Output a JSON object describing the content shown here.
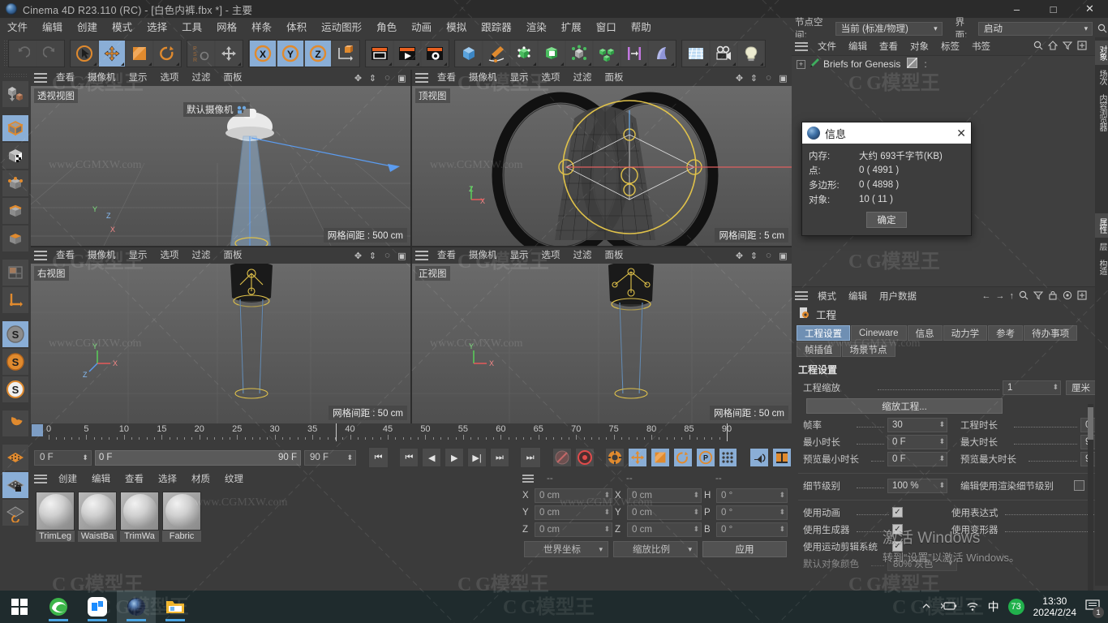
{
  "titlebar": {
    "title": "Cinema 4D R23.110 (RC) - [白色内裤.fbx *] - 主要",
    "minimize": "–",
    "maximize": "□",
    "close": "✕"
  },
  "menubar": {
    "items": [
      "文件",
      "编辑",
      "创建",
      "模式",
      "选择",
      "工具",
      "网格",
      "样条",
      "体积",
      "运动图形",
      "角色",
      "动画",
      "模拟",
      "跟踪器",
      "渲染",
      "扩展",
      "窗口",
      "帮助"
    ]
  },
  "topright": {
    "node_space_label": "节点空间:",
    "node_space_value": "当前 (标准/物理)",
    "layout_label": "界面:",
    "layout_value": "启动",
    "search_icon": "search-icon"
  },
  "object_manager": {
    "menu": [
      "文件",
      "编辑",
      "查看",
      "对象",
      "标签",
      "书签"
    ],
    "icons": [
      "search-icon",
      "home-icon",
      "filter-icon",
      "plus-icon"
    ],
    "tree": [
      {
        "expand": "+",
        "name": "Briefs for Genesis",
        "tag": "tag-icon",
        "dots": ":"
      }
    ]
  },
  "attribute_manager": {
    "menu": [
      "模式",
      "编辑",
      "用户数据"
    ],
    "icons": [
      "back-arrow-icon",
      "forward-arrow-icon",
      "up-arrow-icon",
      "search-icon",
      "filter-icon",
      "lock-icon",
      "record-icon",
      "plus-icon"
    ],
    "object_title": "工程",
    "tabs": [
      {
        "label": "工程设置",
        "active": true
      },
      {
        "label": "Cineware",
        "active": false
      },
      {
        "label": "信息",
        "active": false
      },
      {
        "label": "动力学",
        "active": false
      },
      {
        "label": "参考",
        "active": false
      },
      {
        "label": "待办事项",
        "active": false
      },
      {
        "label": "帧插值",
        "active": false
      },
      {
        "label": "场景节点",
        "active": false
      }
    ],
    "section_title": "工程设置",
    "rows_left": [
      {
        "name": "工程缩放",
        "value": "1",
        "unit": "厘米",
        "type": "number_unit"
      },
      {
        "name": "帧率",
        "value": "30",
        "type": "number"
      },
      {
        "name": "最小时长",
        "value": "0 F",
        "type": "number"
      },
      {
        "name": "预览最小时长",
        "value": "0 F",
        "type": "number"
      },
      {
        "name": "细节级别",
        "value": "100 %",
        "type": "number"
      },
      {
        "name": "使用动画",
        "value": "✓",
        "type": "check"
      },
      {
        "name": "使用生成器",
        "value": "✓",
        "type": "check"
      },
      {
        "name": "使用运动剪辑系统",
        "value": "✓",
        "type": "check"
      },
      {
        "name": "默认对象颜色",
        "value": "80% 灰色",
        "type": "select"
      }
    ],
    "rows_right": [
      {
        "name": "工程时长",
        "value": "0",
        "type": "number"
      },
      {
        "name": "最大时长",
        "value": "9",
        "type": "number"
      },
      {
        "name": "预览最大时长",
        "value": "9",
        "type": "number"
      },
      {
        "name": "编辑使用渲染细节级别",
        "value": "",
        "type": "check_off"
      },
      {
        "name": "使用表达式",
        "value": "✓",
        "type": "check"
      },
      {
        "name": "使用变形器",
        "value": "✓",
        "type": "check"
      }
    ],
    "scale_button": "缩放工程..."
  },
  "vertical_tabs": [
    {
      "label": "对象",
      "active": true
    },
    {
      "label": "场次",
      "active": false
    },
    {
      "label": "内容浏览器",
      "active": false
    },
    {
      "label": "属性",
      "active": true
    },
    {
      "label": "层",
      "active": false
    },
    {
      "label": "构造",
      "active": false
    }
  ],
  "viewports": [
    {
      "name": "透视视图",
      "menu": [
        "查看",
        "摄像机",
        "显示",
        "选项",
        "过滤",
        "面板"
      ],
      "grid_spacing": "网格间距 : 500 cm",
      "camera_label": "默认摄像机"
    },
    {
      "name": "顶视图",
      "menu": [
        "查看",
        "摄像机",
        "显示",
        "选项",
        "过滤",
        "面板"
      ],
      "grid_spacing": "网格间距 : 5 cm",
      "camera_label": ""
    },
    {
      "name": "右视图",
      "menu": [
        "查看",
        "摄像机",
        "显示",
        "选项",
        "过滤",
        "面板"
      ],
      "grid_spacing": "网格间距 : 50 cm",
      "camera_label": ""
    },
    {
      "name": "正视图",
      "menu": [
        "查看",
        "摄像机",
        "显示",
        "选项",
        "过滤",
        "面板"
      ],
      "grid_spacing": "网格间距 : 50 cm",
      "camera_label": ""
    }
  ],
  "timeline": {
    "ticks": [
      0,
      5,
      10,
      15,
      20,
      25,
      30,
      35,
      40,
      45,
      50,
      55,
      60,
      65,
      70,
      75,
      80,
      85,
      90
    ],
    "current_frame": "0 F",
    "range_start": "0 F",
    "range_end": "90 F",
    "max_frame": "90 F",
    "end_field": "0 F",
    "transport_icons": [
      "go-start-icon",
      "prev-key-icon",
      "prev-frame-icon",
      "play-icon",
      "next-frame-icon",
      "next-key-icon",
      "go-end-icon"
    ],
    "record_icons": [
      "autokey-icon",
      "record-icon",
      "keyframe-selection-icon"
    ],
    "axis_toggles": [
      "position-icon",
      "scale-icon",
      "rotation-icon",
      "parameter-icon",
      "point-icon"
    ],
    "right_icons": [
      "sound-icon",
      "timeline-icon"
    ]
  },
  "material_manager": {
    "menu": [
      "创建",
      "编辑",
      "查看",
      "选择",
      "材质",
      "纹理"
    ],
    "materials": [
      {
        "name": "TrimLeg"
      },
      {
        "name": "WaistBa"
      },
      {
        "name": "TrimWa"
      },
      {
        "name": "Fabric"
      }
    ]
  },
  "coordinate_manager": {
    "headers": [
      "--",
      "--",
      "--"
    ],
    "rows": [
      {
        "label": "X",
        "pos": "0 cm",
        "label2": "X",
        "size": "0 cm",
        "label3": "H",
        "rot": "0 °"
      },
      {
        "label": "Y",
        "pos": "0 cm",
        "label2": "Y",
        "size": "0 cm",
        "label3": "P",
        "rot": "0 °"
      },
      {
        "label": "Z",
        "pos": "0 cm",
        "label2": "Z",
        "size": "0 cm",
        "label3": "B",
        "rot": "0 °"
      }
    ],
    "coord_system": "世界坐标",
    "size_mode": "缩放比例",
    "apply": "应用"
  },
  "info_dialog": {
    "title": "信息",
    "close": "✕",
    "rows": [
      {
        "key": "内存:",
        "value": "大约 693千字节(KB)"
      },
      {
        "key": "点:",
        "value": "0 ( 4991 )"
      },
      {
        "key": "多边形:",
        "value": "0 ( 4898 )"
      },
      {
        "key": "对象:",
        "value": "10 ( 11 )"
      }
    ],
    "ok": "确定"
  },
  "windows_watermark": {
    "line1": "激活 Windows",
    "line2": "转到“设置”以激活 Windows。"
  },
  "taskbar": {
    "start_icon": "windows-start-icon",
    "apps": [
      {
        "name": "edge-browser-icon"
      },
      {
        "name": "dingtalk-icon"
      },
      {
        "name": "cinema4d-icon"
      },
      {
        "name": "file-explorer-icon"
      }
    ],
    "tray_icons": [
      "chevron-up-icon",
      "battery-icon",
      "wifi-icon"
    ],
    "ime": "中",
    "badge": "73",
    "time": "13:30",
    "date": "2024/2/24",
    "notification_count": "1"
  },
  "watermark_text": "www.CGMXW.com",
  "watermark_logo": "C G模型王",
  "colors": {
    "accent_orange": "#e08a2e",
    "accent_blue": "#8aaed6",
    "panel_bg": "#3b3b3b",
    "viewport_bg": "#5d5d5d"
  }
}
